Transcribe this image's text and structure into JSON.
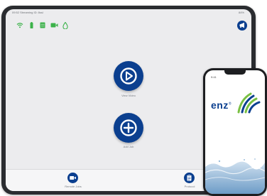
{
  "tablet": {
    "statusbar": {
      "left_text": "09:52  Streaming ID: 8ssl",
      "right_text": "84%"
    },
    "toolbar": {
      "icons": [
        "wifi-icon",
        "battery-icon",
        "grid-icon",
        "camera-icon",
        "water-drop-icon"
      ],
      "fab_icon": "megaphone-icon"
    },
    "main": {
      "view_video_label": "View Video",
      "add_job_label": "Add Job"
    },
    "bottombar": {
      "left_label": "Remote Jobs",
      "right_label": "Protocol"
    }
  },
  "phone": {
    "time": "9:41",
    "brand": "enz",
    "registered_mark": "®"
  },
  "colors": {
    "accent_blue": "#0b3f8f",
    "status_green": "#3cb24a",
    "logo_green": "#7ac043",
    "logo_blue": "#0b3f8f"
  }
}
